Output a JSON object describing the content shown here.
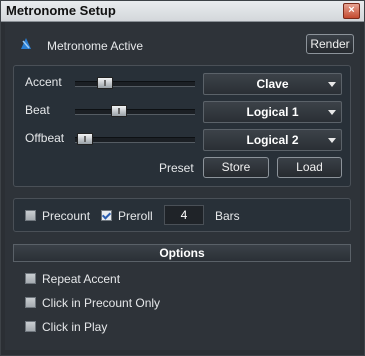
{
  "window": {
    "title": "Metronome Setup",
    "close_glyph": "×"
  },
  "header": {
    "active_label": "Metronome Active",
    "render_label": "Render",
    "icon": "metronome-icon"
  },
  "sliders": [
    {
      "label": "Accent",
      "value_pct": 30,
      "sound": "Clave"
    },
    {
      "label": "Beat",
      "value_pct": 33,
      "sound": "Logical 1"
    },
    {
      "label": "Offbeat",
      "value_pct": 5,
      "sound": "Logical 2"
    }
  ],
  "preset": {
    "label": "Preset",
    "store_label": "Store",
    "load_label": "Load"
  },
  "count": {
    "precount_label": "Precount",
    "precount_checked": false,
    "preroll_label": "Preroll",
    "preroll_checked": true,
    "bars_value": "4",
    "bars_label": "Bars"
  },
  "options": {
    "title": "Options",
    "items": [
      {
        "label": "Repeat Accent",
        "checked": false
      },
      {
        "label": "Click in Precount Only",
        "checked": false
      },
      {
        "label": "Click in Play",
        "checked": false
      }
    ]
  },
  "colors": {
    "accent": "#2a7fd4",
    "background": "#2e3339"
  }
}
